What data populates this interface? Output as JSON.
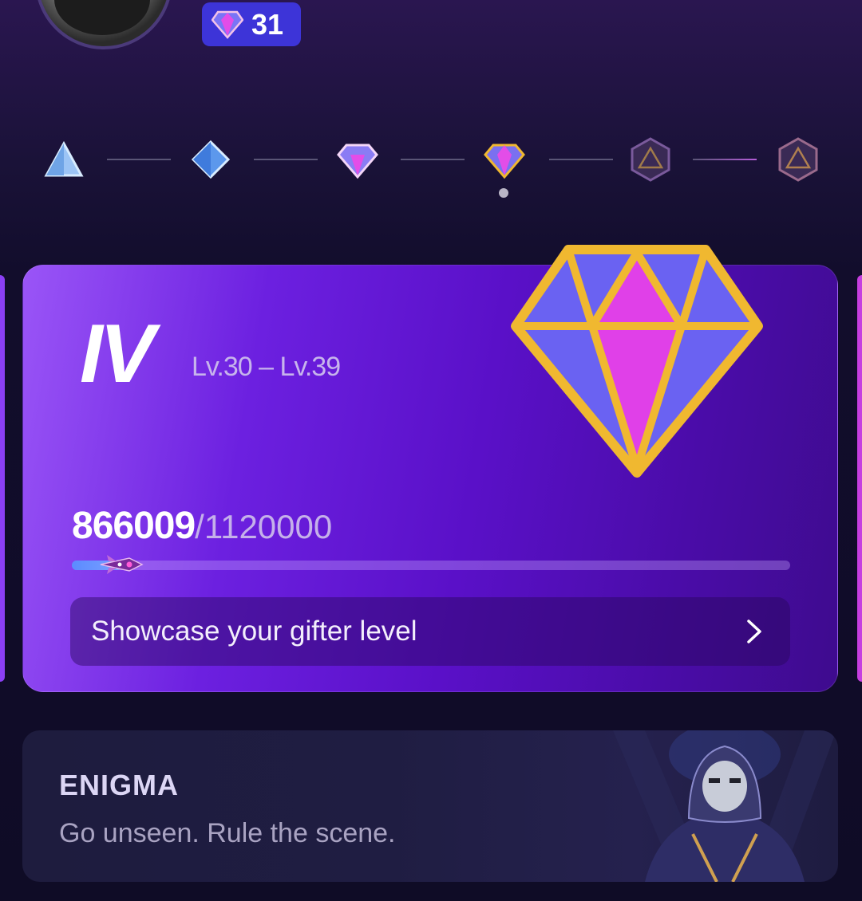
{
  "header": {
    "diamond_count": "31"
  },
  "tiers": [
    {
      "name": "tier-1-icon"
    },
    {
      "name": "tier-2-icon"
    },
    {
      "name": "tier-3-icon"
    },
    {
      "name": "tier-4-icon",
      "current": true
    },
    {
      "name": "tier-5-icon",
      "locked": true
    },
    {
      "name": "tier-6-icon",
      "locked": true
    }
  ],
  "level_card": {
    "tier_roman": "IV",
    "level_range": "Lv.30 – Lv.39",
    "progress_current": "866009",
    "progress_total": "/1120000",
    "progress_fraction": 0.07,
    "showcase_label": "Showcase your gifter level"
  },
  "promo": {
    "title": "ENIGMA",
    "subtitle": "Go unseen. Rule the scene."
  },
  "colors": {
    "accent": "#6c20e0",
    "badge": "#3d34d8",
    "gold": "#f0b830",
    "gem_pink": "#e040e8",
    "gem_blue": "#6a62f2"
  }
}
